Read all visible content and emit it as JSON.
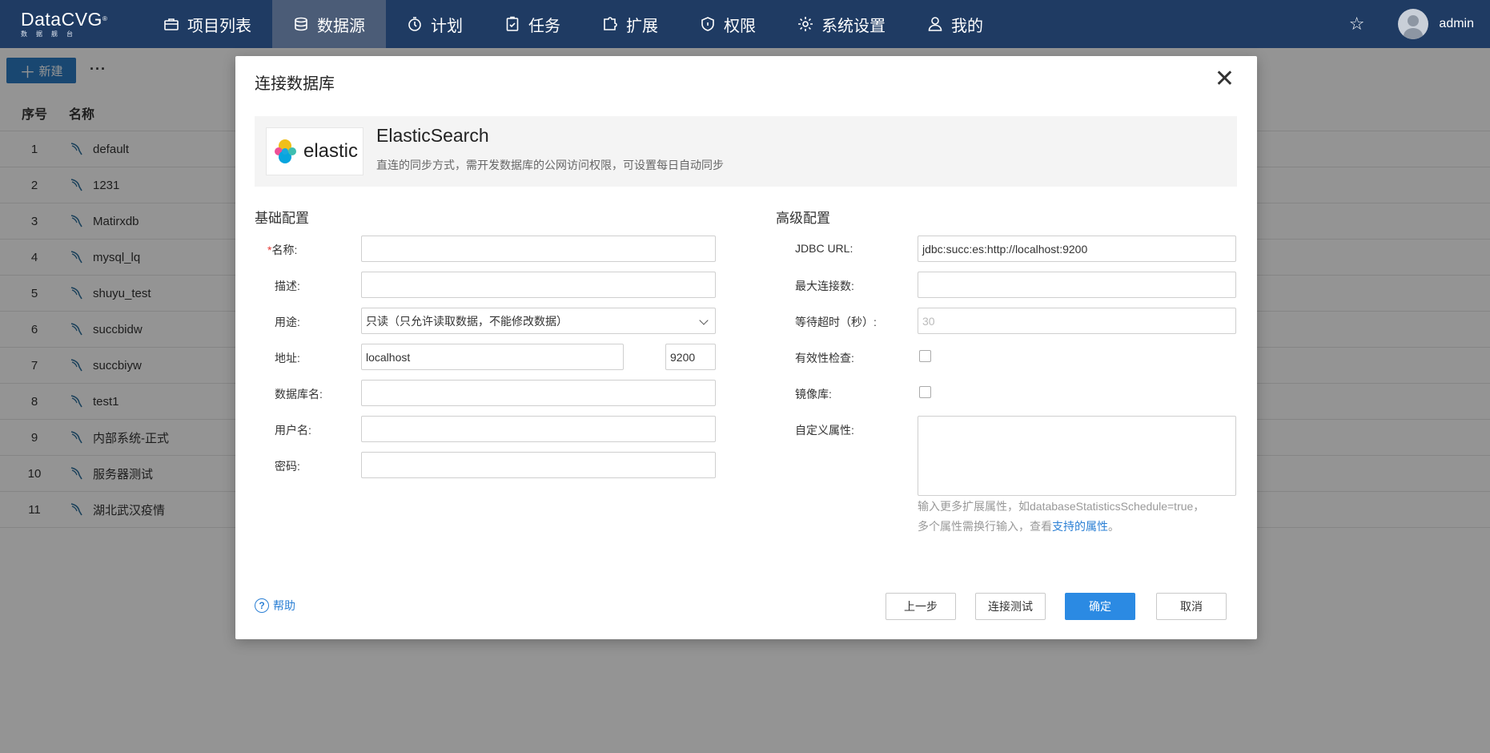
{
  "app": {
    "logo_main": "DataCVG",
    "logo_reg": "®",
    "logo_sub": "数据舰台"
  },
  "nav": {
    "items": [
      {
        "label": "项目列表",
        "icon": "briefcase-icon"
      },
      {
        "label": "数据源",
        "icon": "database-icon"
      },
      {
        "label": "计划",
        "icon": "timer-icon"
      },
      {
        "label": "任务",
        "icon": "clipboard-check-icon"
      },
      {
        "label": "扩展",
        "icon": "puzzle-icon"
      },
      {
        "label": "权限",
        "icon": "shield-icon"
      },
      {
        "label": "系统设置",
        "icon": "gear-icon"
      },
      {
        "label": "我的",
        "icon": "user-icon"
      }
    ],
    "active": "数据源",
    "user": "admin"
  },
  "toolbar": {
    "new_label": "新建",
    "more_label": "···"
  },
  "list": {
    "col_index": "序号",
    "col_name": "名称",
    "rows": [
      {
        "index": "1",
        "name": "default"
      },
      {
        "index": "2",
        "name": "1231"
      },
      {
        "index": "3",
        "name": "Matirxdb"
      },
      {
        "index": "4",
        "name": "mysql_lq"
      },
      {
        "index": "5",
        "name": "shuyu_test"
      },
      {
        "index": "6",
        "name": "succbidw"
      },
      {
        "index": "7",
        "name": "succbiyw"
      },
      {
        "index": "8",
        "name": "test1"
      },
      {
        "index": "9",
        "name": "内部系统-正式"
      },
      {
        "index": "10",
        "name": "服务器测试"
      },
      {
        "index": "11",
        "name": "湖北武汉疫情"
      }
    ]
  },
  "modal": {
    "title": "连接数据库",
    "close": "✕",
    "source": {
      "logo_text": "elastic",
      "name": "ElasticSearch",
      "desc": "直连的同步方式，需开发数据库的公网访问权限，可设置每日自动同步"
    },
    "basic": {
      "title": "基础配置",
      "name_label": "名称:",
      "name_value": "",
      "desc_label": "描述:",
      "desc_value": "",
      "usage_label": "用途:",
      "usage_value": "只读（只允许读取数据，不能修改数据）",
      "address_label": "地址:",
      "host_value": "localhost",
      "port_value": "9200",
      "dbname_label": "数据库名:",
      "dbname_value": "",
      "username_label": "用户名:",
      "username_value": "",
      "password_label": "密码:",
      "password_value": ""
    },
    "advanced": {
      "title": "高级配置",
      "jdbc_label": "JDBC URL:",
      "jdbc_value": "jdbc:succ:es:http://localhost:9200",
      "maxconn_label": "最大连接数:",
      "maxconn_value": "",
      "timeout_label": "等待超时（秒）:",
      "timeout_placeholder": "30",
      "validity_label": "有效性检查:",
      "mirror_label": "镜像库:",
      "custom_label": "自定义属性:",
      "hint_line1": "输入更多扩展属性，如databaseStatisticsSchedule=true，",
      "hint_line2_prefix": "多个属性需换行输入，查看",
      "hint_link": "支持的属性",
      "hint_line2_suffix": "。"
    },
    "footer": {
      "help": "帮助",
      "prev": "上一步",
      "test": "连接测试",
      "ok": "确定",
      "cancel": "取消"
    }
  },
  "colors": {
    "nav_bg": "#1f3b63",
    "nav_active": "#4b5c77",
    "primary": "#2b8ae3",
    "link": "#2a7fd4"
  }
}
